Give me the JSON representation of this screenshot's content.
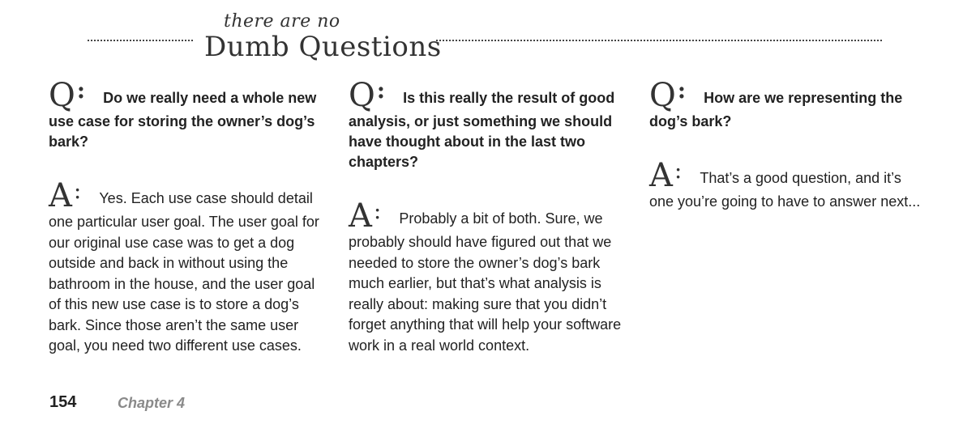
{
  "header": {
    "title_small": "there are no",
    "title_big": "Dumb Questions"
  },
  "qa_letters": {
    "q": "Q",
    "a": "A",
    "colon": ":"
  },
  "columns": [
    {
      "question": "Do we really need a whole new use case for storing the owner’s dog’s bark?",
      "answer": "Yes. Each use case should detail one particular user goal. The user goal for our original use case was to get a dog outside and back in without using the bathroom in the house, and the user goal of this new use case is to store a dog’s bark. Since those aren’t the same user goal, you need two different use cases."
    },
    {
      "question": "Is this really the result of good analysis, or just something we should have thought about in the last two chapters?",
      "answer": "Probably a bit of both. Sure, we probably should have figured out that we needed to store the owner’s dog’s bark much earlier, but that’s what analysis is really about: making sure that you didn’t forget anything that will help your software work in a real world context."
    },
    {
      "question": "How are we representing the dog’s bark?",
      "answer": "That’s a good question, and it’s one you’re going to have to answer next..."
    }
  ],
  "footer": {
    "page_number": "154",
    "chapter": "Chapter 4"
  }
}
